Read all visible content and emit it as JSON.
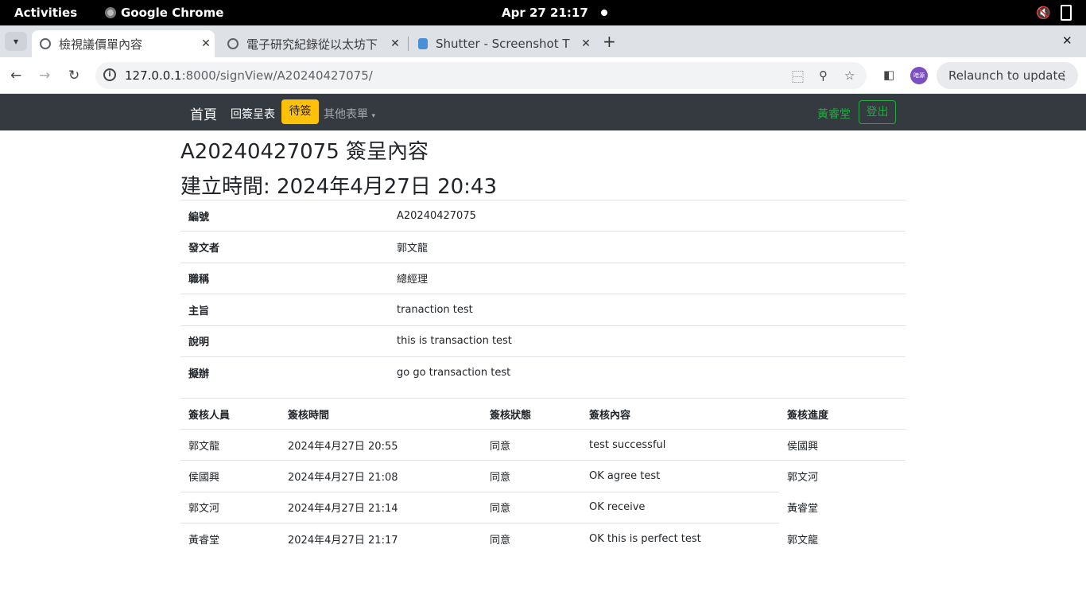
{
  "system": {
    "activities": "Activities",
    "app_name": "Google Chrome",
    "clock": "Apr 27  21:17"
  },
  "tabs": [
    {
      "title": "檢視議價單內容"
    },
    {
      "title": "電子研究紀錄從以太坊下"
    },
    {
      "title": "Shutter - Screenshot T"
    }
  ],
  "omnibox": {
    "host": "127.0.0.1",
    "path": ":8000/signView/A20240427075/"
  },
  "toolbar": {
    "profile_label": "暗源",
    "relaunch_label": "Relaunch to update"
  },
  "navbar": {
    "brand": "首頁",
    "links": [
      "回簽呈表",
      "待簽",
      "其他表單"
    ],
    "user": "黃睿堂",
    "logout": "登出"
  },
  "page": {
    "title": "A20240427075 簽呈內容",
    "created": "建立時間: 2024年4月27日 20:43",
    "details": [
      {
        "key": "編號",
        "value": "A20240427075"
      },
      {
        "key": "發文者",
        "value": "郭文龍"
      },
      {
        "key": "職稱",
        "value": "總經理"
      },
      {
        "key": "主旨",
        "value": "tranaction test"
      },
      {
        "key": "說明",
        "value": "this is transaction test"
      },
      {
        "key": "擬辦",
        "value": "go go transaction test"
      }
    ],
    "sign_headers": [
      "簽核人員",
      "簽核時間",
      "簽核狀態",
      "簽核內容",
      "簽核進度"
    ],
    "sign_rows": [
      [
        "郭文龍",
        "2024年4月27日 20:55",
        "同意",
        "test successful",
        "侯國興"
      ],
      [
        "侯國興",
        "2024年4月27日 21:08",
        "同意",
        "OK agree test",
        "郭文河"
      ],
      [
        "郭文河",
        "2024年4月27日 21:14",
        "同意",
        "OK receive",
        "黃睿堂"
      ],
      [
        "黃睿堂",
        "2024年4月27日 21:17",
        "同意",
        "OK this is perfect test",
        "郭文龍"
      ]
    ]
  }
}
